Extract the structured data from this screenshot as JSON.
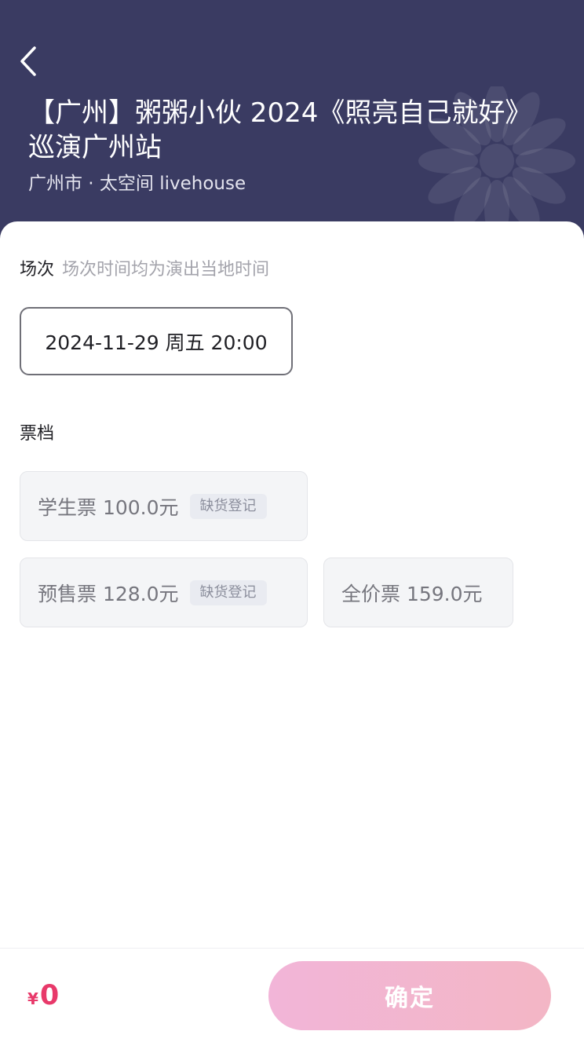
{
  "header": {
    "title": "【广州】粥粥小伙 2024《照亮自己就好》巡演广州站",
    "location": "广州市 · 太空间 livehouse"
  },
  "session_section": {
    "title": "场次",
    "hint": "场次时间均为演出当地时间",
    "options": [
      {
        "label": "2024-11-29 周五 20:00"
      }
    ]
  },
  "tier_section": {
    "title": "票档",
    "tickets": [
      {
        "label": "学生票 100.0元",
        "badge": "缺货登记"
      },
      {
        "label": "预售票 128.0元",
        "badge": "缺货登记"
      },
      {
        "label": "全价票 159.0元"
      }
    ]
  },
  "footer": {
    "currency": "¥",
    "total": "0",
    "confirm_label": "确定"
  },
  "colors": {
    "header_bg": "#3a3b62",
    "price": "#e8396a",
    "confirm_gradient_start": "#f2b5d8",
    "confirm_gradient_end": "#f3b6c5"
  },
  "icons": {
    "back": "chevron-left-icon",
    "decoration": "flower-icon"
  }
}
